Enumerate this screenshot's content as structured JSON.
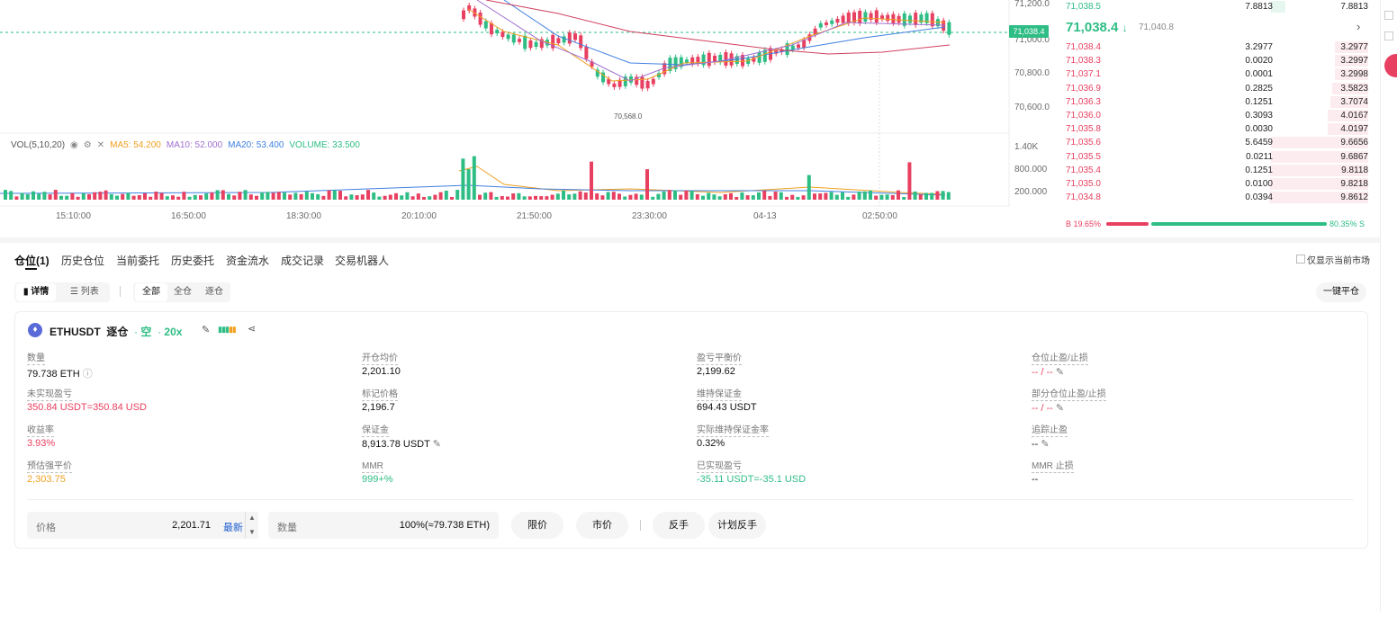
{
  "chart": {
    "price_axis": [
      "71,200.0",
      "71,000.0",
      "70,800.0",
      "70,600.0"
    ],
    "current_price_tag": "71,038.4",
    "low_marker": "70,568.0",
    "vol_axis": [
      "1.40K",
      "800.000",
      "200.000"
    ],
    "time_axis": [
      "15:10:00",
      "16:50:00",
      "18:30:00",
      "20:10:00",
      "21:50:00",
      "23:30:00",
      "04-13",
      "02:50:00"
    ],
    "vol_legend": {
      "title": "VOL(5,10,20)",
      "ma5": "MA5: 54.200",
      "ma10": "MA10: 52.000",
      "ma20": "MA20: 53.400",
      "volume": "VOLUME: 33.500"
    },
    "colors": {
      "up": "#2ebd85",
      "down": "#e84060",
      "ma5": "#f0a020",
      "ma10": "#a070d0",
      "ma20": "#4080e0"
    }
  },
  "orderbook": {
    "top_row": {
      "price": "71,038.5",
      "qty": "7.8813",
      "total": "7.8813"
    },
    "mid_price": "71,038.4",
    "mid_arrow": "↓",
    "mark_price": "71,040.8",
    "asks": [
      {
        "price": "71,038.4",
        "qty": "3.2977",
        "total": "3.2977",
        "depth": 0.34
      },
      {
        "price": "71,038.3",
        "qty": "0.0020",
        "total": "3.2997",
        "depth": 0.34
      },
      {
        "price": "71,037.1",
        "qty": "0.0001",
        "total": "3.2998",
        "depth": 0.34
      },
      {
        "price": "71,036.9",
        "qty": "0.2825",
        "total": "3.5823",
        "depth": 0.36
      },
      {
        "price": "71,036.3",
        "qty": "0.1251",
        "total": "3.7074",
        "depth": 0.38
      },
      {
        "price": "71,036.0",
        "qty": "0.3093",
        "total": "4.0167",
        "depth": 0.41
      },
      {
        "price": "71,035.8",
        "qty": "0.0030",
        "total": "4.0197",
        "depth": 0.41
      },
      {
        "price": "71,035.6",
        "qty": "5.6459",
        "total": "9.6656",
        "depth": 0.98
      },
      {
        "price": "71,035.5",
        "qty": "0.0211",
        "total": "9.6867",
        "depth": 0.98
      },
      {
        "price": "71,035.4",
        "qty": "0.1251",
        "total": "9.8118",
        "depth": 0.99
      },
      {
        "price": "71,035.0",
        "qty": "0.0100",
        "total": "9.8218",
        "depth": 0.99
      },
      {
        "price": "71,034.8",
        "qty": "0.0394",
        "total": "9.8612",
        "depth": 1.0
      }
    ],
    "buy_ratio": "B 19.65%",
    "sell_ratio": "80.35% S",
    "buy_fraction": 0.1965
  },
  "tabs": [
    "仓位(1)",
    "历史仓位",
    "当前委托",
    "历史委托",
    "资金流水",
    "成交记录",
    "交易机器人"
  ],
  "only_current_market": "仅显示当前市场",
  "view_modes": {
    "detail": "详情",
    "list": "列表"
  },
  "filters": {
    "all": "全部",
    "cross": "全仓",
    "isolated": "逐仓"
  },
  "close_all": "一键平仓",
  "position": {
    "symbol": "ETHUSDT",
    "margin_mode": "逐仓",
    "side": "空",
    "leverage": "20x",
    "fields": {
      "qty_label": "数量",
      "qty": "79.738 ETH",
      "entry_label": "开仓均价",
      "entry": "2,201.10",
      "breakeven_label": "盈亏平衡价",
      "breakeven": "2,199.62",
      "tpsl_label": "仓位止盈/止损",
      "tpsl": "-- / --",
      "upnl_label": "未实现盈亏",
      "upnl": "350.84 USDT=350.84 USD",
      "mark_label": "标记价格",
      "mark": "2,196.7",
      "maint_label": "维持保证金",
      "maint": "694.43 USDT",
      "partial_label": "部分仓位止盈/止损",
      "partial": "-- / --",
      "roe_label": "收益率",
      "roe": "3.93%",
      "margin_label": "保证金",
      "margin": "8,913.78 USDT",
      "mmr_actual_label": "实际维持保证金率",
      "mmr_actual": "0.32%",
      "trailing_label": "追踪止盈",
      "trailing": "--",
      "liq_label": "预估强平价",
      "liq": "2,303.75",
      "mmr_label": "MMR",
      "mmr": "999+%",
      "rpnl_label": "已实现盈亏",
      "rpnl": "-35.11 USDT=-35.1 USD",
      "mmr_sl_label": "MMR 止损",
      "mmr_sl": "--"
    },
    "close_form": {
      "price_label": "价格",
      "price_value": "2,201.71",
      "latest": "最新",
      "qty_label": "数量",
      "qty_value": "100%(≈79.738 ETH)",
      "limit": "限价",
      "market": "市价",
      "reverse": "反手",
      "plan_reverse": "计划反手"
    }
  }
}
